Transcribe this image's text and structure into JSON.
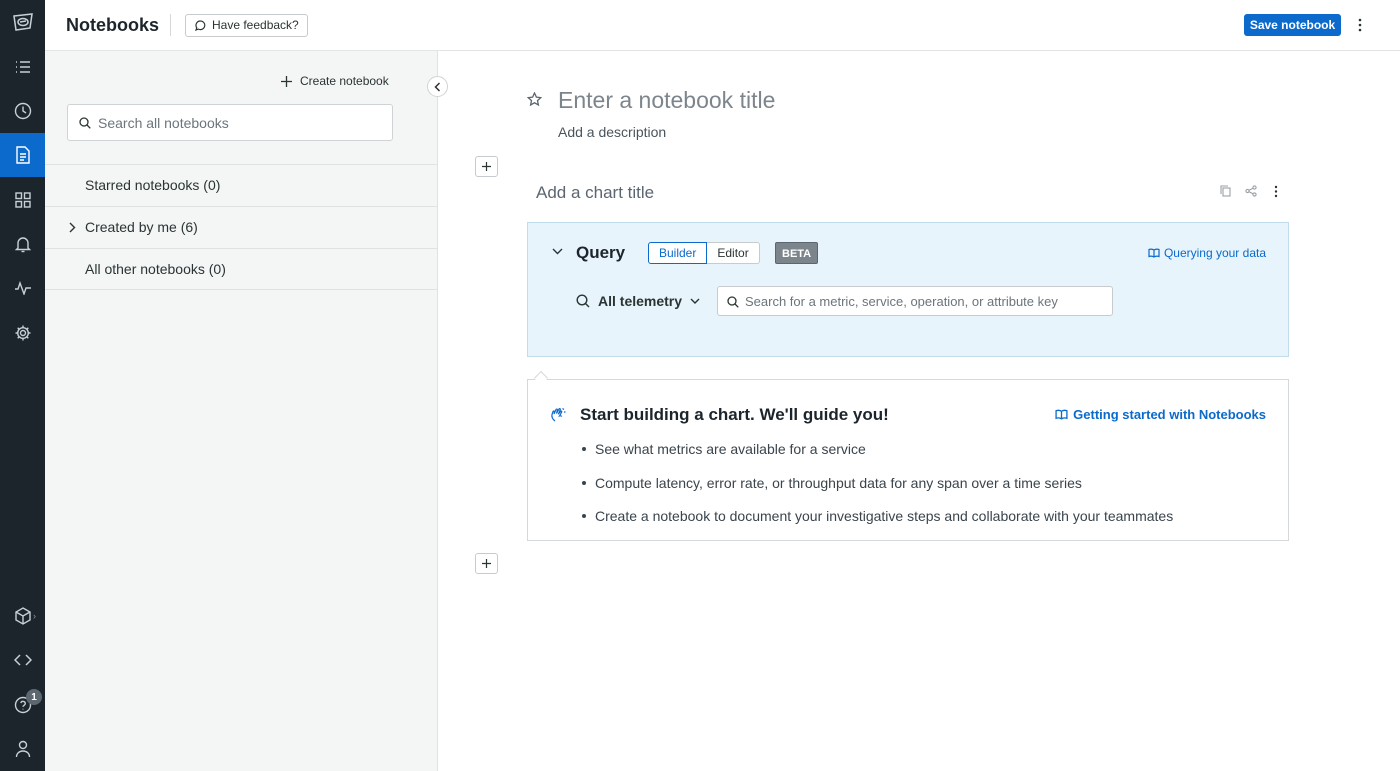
{
  "colors": {
    "rail_bg": "#1d252c",
    "accent": "#0b6acb",
    "query_bg": "#e8f4fb"
  },
  "rail": {
    "items": [
      {
        "icon": "logo-icon"
      },
      {
        "icon": "list-icon"
      },
      {
        "icon": "clock-icon"
      },
      {
        "icon": "notebook-icon",
        "active": true
      },
      {
        "icon": "dashboard-grid-icon"
      },
      {
        "icon": "bell-icon"
      },
      {
        "icon": "activity-icon"
      },
      {
        "icon": "gear-icon"
      },
      {
        "icon": "package-icon"
      },
      {
        "icon": "code-icon"
      },
      {
        "icon": "help-icon"
      },
      {
        "icon": "user-icon"
      }
    ],
    "help_badge": "1"
  },
  "header": {
    "title": "Notebooks",
    "feedback_label": "Have feedback?",
    "save_label": "Save notebook"
  },
  "sidebar": {
    "create_label": "Create notebook",
    "search_placeholder": "Search all notebooks",
    "sections": [
      {
        "label": "Starred notebooks (0)",
        "expandable": false
      },
      {
        "label": "Created by me (6)",
        "expandable": true
      },
      {
        "label": "All other notebooks (0)",
        "expandable": false
      }
    ]
  },
  "notebook": {
    "title_placeholder": "Enter a notebook title",
    "description_placeholder": "Add a description",
    "chart_title_placeholder": "Add a chart title"
  },
  "query": {
    "label": "Query",
    "modes": [
      "Builder",
      "Editor"
    ],
    "selected_mode": "Builder",
    "beta_label": "BETA",
    "help_link": "Querying your data",
    "telemetry_select": "All telemetry",
    "search_placeholder": "Search for a metric, service, operation, or attribute key"
  },
  "guide": {
    "title": "Start building a chart. We'll guide you!",
    "link": "Getting started with Notebooks",
    "items": [
      "See what metrics are available for a service",
      "Compute latency, error rate, or throughput data for any span over a time series",
      "Create a notebook to document your investigative steps and collaborate with your teammates"
    ]
  }
}
